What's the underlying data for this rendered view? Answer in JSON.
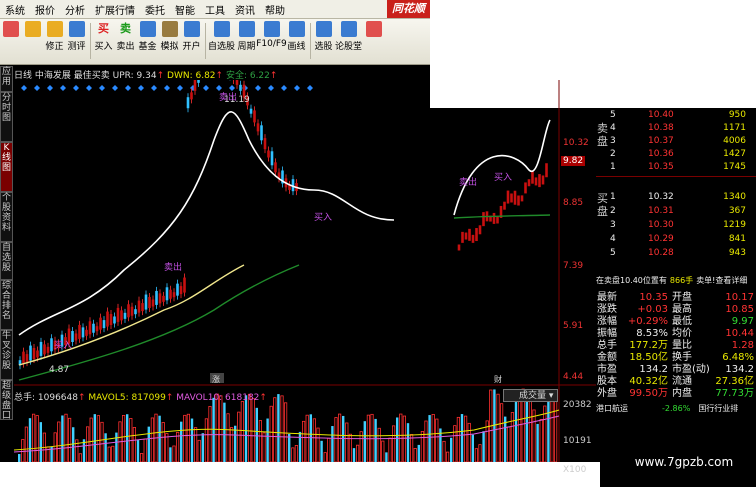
{
  "menubar": {
    "items": [
      "系统",
      "报价",
      "分析",
      "扩展行情",
      "委托",
      "智能",
      "工具",
      "资讯",
      "帮助"
    ],
    "brand": "同花顺"
  },
  "toolbar": {
    "buttons": [
      {
        "label": "",
        "icon": "app-icon",
        "color": "#d33"
      },
      {
        "label": "",
        "icon": "back-arrow-icon",
        "color": "#e8a000"
      },
      {
        "label": "修正",
        "icon": "up-down-icon",
        "color": "#e8a000"
      },
      {
        "label": "测评",
        "icon": "calendar-icon",
        "color": "#1a66cc"
      },
      {
        "label": "买入",
        "icon": "buy-icon",
        "color": "#d22",
        "text": "买"
      },
      {
        "label": "卖出",
        "icon": "sell-icon",
        "color": "#1a9a1a",
        "text": "卖"
      },
      {
        "label": "基金",
        "icon": "fund-icon",
        "color": "#1a66cc"
      },
      {
        "label": "模拟",
        "icon": "hammer-icon",
        "color": "#886622"
      },
      {
        "label": "开户",
        "icon": "open-account-icon",
        "color": "#1a66cc"
      },
      {
        "label": "自选股",
        "icon": "plus-icon",
        "color": "#1a66cc"
      },
      {
        "label": "周期",
        "icon": "clock-icon",
        "color": "#1a66cc"
      },
      {
        "label": "F10/F9",
        "icon": "document-icon",
        "color": "#1a66cc"
      },
      {
        "label": "画线",
        "icon": "pen-icon",
        "color": "#1a66cc"
      },
      {
        "label": "选股",
        "icon": "select-stock-icon",
        "color": "#1a66cc"
      },
      {
        "label": "论股堂",
        "icon": "forum-icon",
        "color": "#1a66cc"
      },
      {
        "label": "",
        "icon": "more-icon",
        "color": "#d33"
      }
    ]
  },
  "left_tabs": [
    "应用",
    "分时图",
    "K线图",
    "个股资料",
    "自选股",
    "综合排名",
    "牛叉诊股",
    "超级盘口"
  ],
  "chart": {
    "period": "日线",
    "stock": "中海发展",
    "indicator": "最佳买卖",
    "upr": "UPR: 9.34",
    "dwn": "DWN: 6.82",
    "safe": "安全: 6.22",
    "marks": [
      "卖出",
      "买入",
      "卖出",
      "买入",
      "卖出",
      "买入"
    ],
    "annot_peak": "11.19",
    "annot_low": "4.87",
    "annot_flag1": "涨",
    "annot_flag2": "财",
    "y_labels": [
      "10.32",
      "9.82",
      "8.85",
      "7.39",
      "5.91",
      "4.44"
    ],
    "highlight_price": "9.82"
  },
  "volume": {
    "label": "总手: 1096648",
    "mavol5": "MAVOL5: 817099",
    "mavol10": "MAVOL10: 618182",
    "select": "成交量",
    "y_labels": [
      "20382",
      "10191",
      "X100"
    ]
  },
  "orderbook": {
    "sell_label": "卖盘",
    "buy_label": "买盘",
    "sells": [
      {
        "level": "5",
        "price": "10.40",
        "vol": "950"
      },
      {
        "level": "4",
        "price": "10.38",
        "vol": "1171"
      },
      {
        "level": "3",
        "price": "10.37",
        "vol": "4006"
      },
      {
        "level": "2",
        "price": "10.36",
        "vol": "1427"
      },
      {
        "level": "1",
        "price": "10.35",
        "vol": "1745"
      }
    ],
    "buys": [
      {
        "level": "1",
        "price": "10.32",
        "vol": "1340"
      },
      {
        "level": "2",
        "price": "10.31",
        "vol": "367"
      },
      {
        "level": "3",
        "price": "10.30",
        "vol": "1219"
      },
      {
        "level": "4",
        "price": "10.29",
        "vol": "841"
      },
      {
        "level": "5",
        "price": "10.28",
        "vol": "943"
      }
    ],
    "queue_text": "在卖盘10.40位置有",
    "queue_vol": "866手",
    "queue_link": "卖单!查看详细"
  },
  "stats": [
    {
      "l1": "最新",
      "v1": "10.35",
      "l2": "开盘",
      "v2": "10.17",
      "c1": "red",
      "c2": "red"
    },
    {
      "l1": "涨跌",
      "v1": "+0.03",
      "l2": "最高",
      "v2": "10.85",
      "c1": "red",
      "c2": "red"
    },
    {
      "l1": "涨幅",
      "v1": "+0.29%",
      "l2": "最低",
      "v2": "9.97",
      "c1": "red",
      "c2": "green"
    },
    {
      "l1": "振幅",
      "v1": "8.53%",
      "l2": "均价",
      "v2": "10.44",
      "c1": "white",
      "c2": "red"
    },
    {
      "l1": "总手",
      "v1": "177.2万",
      "l2": "量比",
      "v2": "1.28",
      "c1": "yellowc",
      "c2": "red"
    },
    {
      "l1": "金额",
      "v1": "18.50亿",
      "l2": "换手",
      "v2": "6.48%",
      "c1": "yellowc",
      "c2": "yellowc"
    },
    {
      "l1": "市盈",
      "v1": "134.2",
      "l2": "市盈(动)",
      "v2": "134.2",
      "c1": "white",
      "c2": "white"
    },
    {
      "l1": "股本",
      "v1": "40.32亿",
      "l2": "流通",
      "v2": "27.36亿",
      "c1": "yellowc",
      "c2": "yellowc"
    },
    {
      "l1": "外盘",
      "v1": "99.50万",
      "l2": "内盘",
      "v2": "77.73万",
      "c1": "red",
      "c2": "green"
    }
  ],
  "bottom_tabs": {
    "left": "港口航运",
    "mid": "-2.86%",
    "right": "国行行业排"
  },
  "watermark": "www.7gpzb.com"
}
